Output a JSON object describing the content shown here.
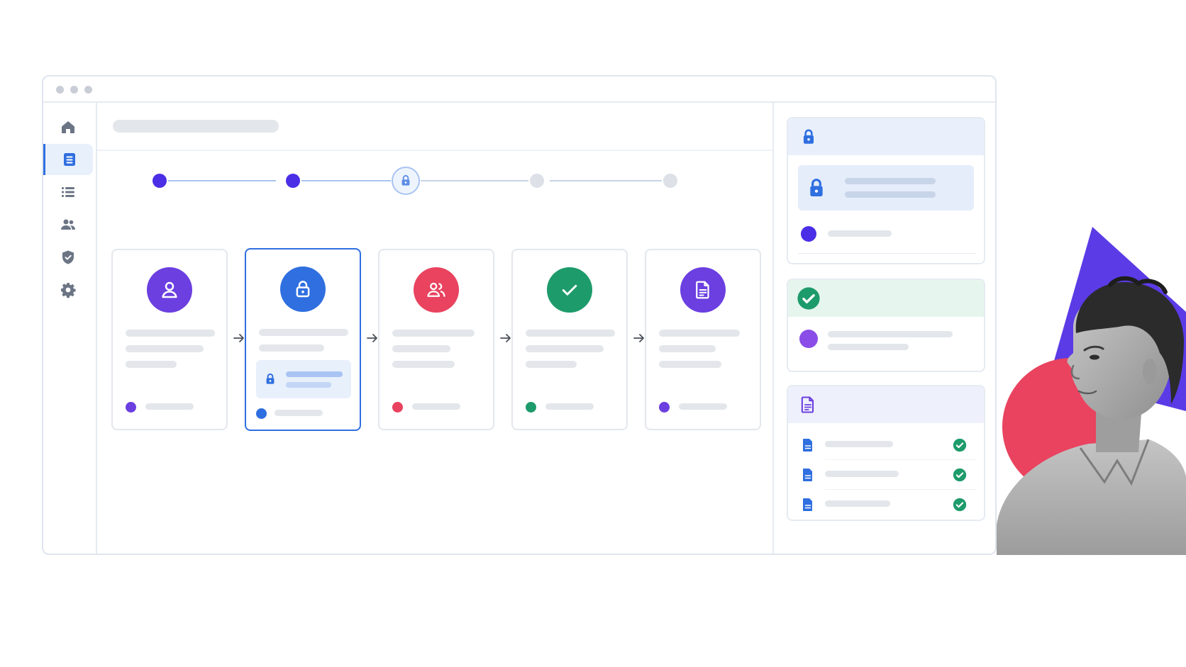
{
  "window": {
    "controls": [
      "close",
      "minimize",
      "maximize"
    ]
  },
  "sidebar": {
    "items": [
      {
        "icon": "home-icon",
        "active": false
      },
      {
        "icon": "document-icon",
        "active": true
      },
      {
        "icon": "list-icon",
        "active": false
      },
      {
        "icon": "users-icon",
        "active": false
      },
      {
        "icon": "shield-icon",
        "active": false
      },
      {
        "icon": "gear-icon",
        "active": false
      }
    ]
  },
  "stepper": {
    "steps": [
      {
        "state": "complete"
      },
      {
        "state": "complete"
      },
      {
        "state": "locked"
      },
      {
        "state": "pending"
      },
      {
        "state": "pending"
      }
    ]
  },
  "cards": [
    {
      "icon": "user-icon",
      "color": "#6b3fe0"
    },
    {
      "icon": "lock-icon",
      "color": "#2f6fe0",
      "active": true
    },
    {
      "icon": "users-icon",
      "color": "#e9435f"
    },
    {
      "icon": "check-icon",
      "color": "#1e9b6b"
    },
    {
      "icon": "file-icon",
      "color": "#6b3fe0"
    }
  ],
  "colors": {
    "accent": "#2f6fe0",
    "purple": "#6b3fe0",
    "indigo": "#4a2fe6",
    "red": "#e9435f",
    "green": "#1e9b6b"
  },
  "right_panel": {
    "security_card": {
      "icon": "lock-icon"
    },
    "verified_card": {
      "icon": "check-circle-icon"
    },
    "documents_card": {
      "icon": "file-icon",
      "rows": 3
    }
  }
}
